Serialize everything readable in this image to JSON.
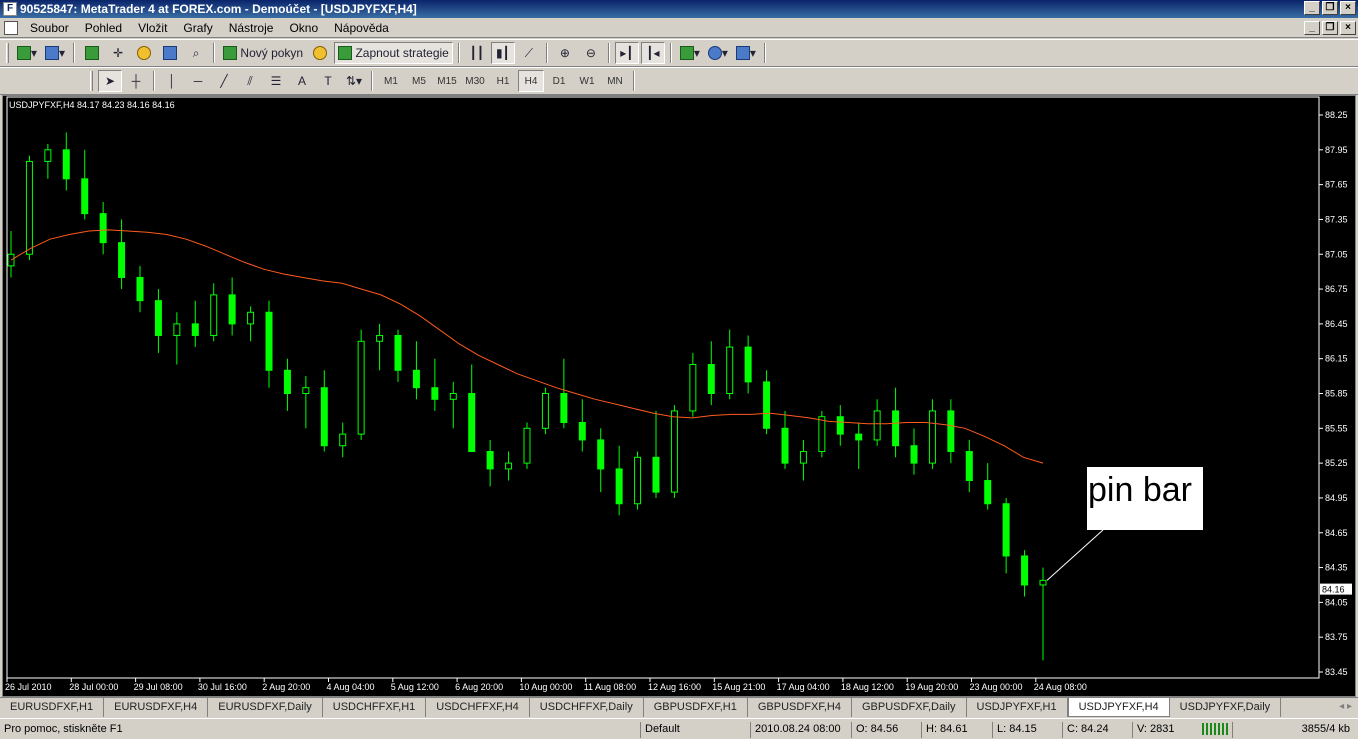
{
  "window": {
    "title": "90525847: MetaTrader 4 at FOREX.com - Demoúčet - [USDJPYFXF,H4]"
  },
  "menu": [
    "Soubor",
    "Pohled",
    "Vložit",
    "Grafy",
    "Nástroje",
    "Okno",
    "Nápověda"
  ],
  "toolbar": {
    "new_order": "Nový pokyn",
    "expert_advisors": "Zapnout strategie"
  },
  "timeframes": [
    "M1",
    "M5",
    "M15",
    "M30",
    "H1",
    "H4",
    "D1",
    "W1",
    "MN"
  ],
  "active_timeframe": "H4",
  "chart": {
    "header": "USDJPYFXF,H4  84.17 84.23 84.16 84.16",
    "price_labels": [
      "88.25",
      "87.95",
      "87.65",
      "87.35",
      "87.05",
      "86.75",
      "86.45",
      "86.15",
      "85.85",
      "85.55",
      "85.25",
      "84.95",
      "84.65",
      "84.35",
      "84.05",
      "83.75",
      "83.45"
    ],
    "current_price": "84.16",
    "time_labels": [
      "26 Jul 2010",
      "28 Jul 00:00",
      "29 Jul 08:00",
      "30 Jul 16:00",
      "2 Aug 20:00",
      "4 Aug 04:00",
      "5 Aug 12:00",
      "6 Aug 20:00",
      "10 Aug 00:00",
      "11 Aug 08:00",
      "12 Aug 16:00",
      "15 Aug 21:00",
      "17 Aug 04:00",
      "18 Aug 12:00",
      "19 Aug 20:00",
      "23 Aug 00:00",
      "24 Aug 08:00"
    ],
    "annotation": "pin bar",
    "colors": {
      "background": "#000000",
      "bull": "#00ff00",
      "bear": "#00ff00",
      "ma": "#ff5a1e",
      "axis": "#ffffff"
    }
  },
  "chart_data": {
    "type": "candlestick",
    "title": "USDJPYFXF,H4",
    "ylim": [
      83.45,
      88.25
    ],
    "ma_series": [
      87.0,
      87.1,
      87.18,
      87.22,
      87.25,
      87.26,
      87.25,
      87.24,
      87.22,
      87.18,
      87.12,
      87.05,
      86.98,
      86.92,
      86.88,
      86.85,
      86.82,
      86.8,
      86.75,
      86.7,
      86.62,
      86.52,
      86.4,
      86.28,
      86.18,
      86.1,
      86.02,
      85.96,
      85.9,
      85.85,
      85.8,
      85.76,
      85.72,
      85.68,
      85.65,
      85.64,
      85.66,
      85.67,
      85.67,
      85.68,
      85.66,
      85.64,
      85.61,
      85.6,
      85.59,
      85.59,
      85.6,
      85.6,
      85.58,
      85.55,
      85.48,
      85.4,
      85.3,
      85.25
    ],
    "candles": [
      [
        86.95,
        87.25,
        86.85,
        87.05
      ],
      [
        87.05,
        87.9,
        87.0,
        87.85
      ],
      [
        87.85,
        88.0,
        87.7,
        87.95
      ],
      [
        87.95,
        88.1,
        87.6,
        87.7
      ],
      [
        87.7,
        87.95,
        87.35,
        87.4
      ],
      [
        87.4,
        87.5,
        87.05,
        87.15
      ],
      [
        87.15,
        87.35,
        86.75,
        86.85
      ],
      [
        86.85,
        86.95,
        86.55,
        86.65
      ],
      [
        86.65,
        86.75,
        86.2,
        86.35
      ],
      [
        86.35,
        86.55,
        86.1,
        86.45
      ],
      [
        86.45,
        86.65,
        86.25,
        86.35
      ],
      [
        86.35,
        86.8,
        86.3,
        86.7
      ],
      [
        86.7,
        86.85,
        86.35,
        86.45
      ],
      [
        86.45,
        86.6,
        86.3,
        86.55
      ],
      [
        86.55,
        86.65,
        85.9,
        86.05
      ],
      [
        86.05,
        86.15,
        85.7,
        85.85
      ],
      [
        85.85,
        86.0,
        85.55,
        85.9
      ],
      [
        85.9,
        86.05,
        85.35,
        85.4
      ],
      [
        85.4,
        85.6,
        85.3,
        85.5
      ],
      [
        85.5,
        86.4,
        85.45,
        86.3
      ],
      [
        86.3,
        86.45,
        86.05,
        86.35
      ],
      [
        86.35,
        86.4,
        85.95,
        86.05
      ],
      [
        86.05,
        86.3,
        85.8,
        85.9
      ],
      [
        85.9,
        86.15,
        85.7,
        85.8
      ],
      [
        85.8,
        85.95,
        85.55,
        85.85
      ],
      [
        85.85,
        86.1,
        85.4,
        85.35
      ],
      [
        85.35,
        85.45,
        85.05,
        85.2
      ],
      [
        85.2,
        85.35,
        85.1,
        85.25
      ],
      [
        85.25,
        85.6,
        85.2,
        85.55
      ],
      [
        85.55,
        85.9,
        85.5,
        85.85
      ],
      [
        85.85,
        86.15,
        85.55,
        85.6
      ],
      [
        85.6,
        85.8,
        85.35,
        85.45
      ],
      [
        85.45,
        85.55,
        85.0,
        85.2
      ],
      [
        85.2,
        85.4,
        84.8,
        84.9
      ],
      [
        84.9,
        85.35,
        84.85,
        85.3
      ],
      [
        85.3,
        85.7,
        84.95,
        85.0
      ],
      [
        85.0,
        85.75,
        84.95,
        85.7
      ],
      [
        85.7,
        86.2,
        85.65,
        86.1
      ],
      [
        86.1,
        86.3,
        85.75,
        85.85
      ],
      [
        85.85,
        86.4,
        85.8,
        86.25
      ],
      [
        86.25,
        86.35,
        85.85,
        85.95
      ],
      [
        85.95,
        86.05,
        85.5,
        85.55
      ],
      [
        85.55,
        85.7,
        85.2,
        85.25
      ],
      [
        85.25,
        85.45,
        85.1,
        85.35
      ],
      [
        85.35,
        85.7,
        85.3,
        85.65
      ],
      [
        85.65,
        85.75,
        85.4,
        85.5
      ],
      [
        85.5,
        85.6,
        85.2,
        85.45
      ],
      [
        85.45,
        85.8,
        85.4,
        85.7
      ],
      [
        85.7,
        85.9,
        85.3,
        85.4
      ],
      [
        85.4,
        85.55,
        85.15,
        85.25
      ],
      [
        85.25,
        85.8,
        85.2,
        85.7
      ],
      [
        85.7,
        85.8,
        85.25,
        85.35
      ],
      [
        85.35,
        85.45,
        85.0,
        85.1
      ],
      [
        85.1,
        85.25,
        84.85,
        84.9
      ],
      [
        84.9,
        84.95,
        84.3,
        84.45
      ],
      [
        84.45,
        84.5,
        84.1,
        84.2
      ],
      [
        84.2,
        84.35,
        83.55,
        84.24
      ]
    ]
  },
  "tabs": [
    "EURUSDFXF,H1",
    "EURUSDFXF,H4",
    "EURUSDFXF,Daily",
    "USDCHFFXF,H1",
    "USDCHFFXF,H4",
    "USDCHFFXF,Daily",
    "GBPUSDFXF,H1",
    "GBPUSDFXF,H4",
    "GBPUSDFXF,Daily",
    "USDJPYFXF,H1",
    "USDJPYFXF,H4",
    "USDJPYFXF,Daily"
  ],
  "active_tab": "USDJPYFXF,H4",
  "status": {
    "help": "Pro pomoc, stiskněte F1",
    "profile": "Default",
    "datetime": "2010.08.24 08:00",
    "open": "O: 84.56",
    "high": "H: 84.61",
    "low": "L: 84.15",
    "close": "C: 84.24",
    "volume": "V: 2831",
    "traffic": "3855/4 kb"
  }
}
